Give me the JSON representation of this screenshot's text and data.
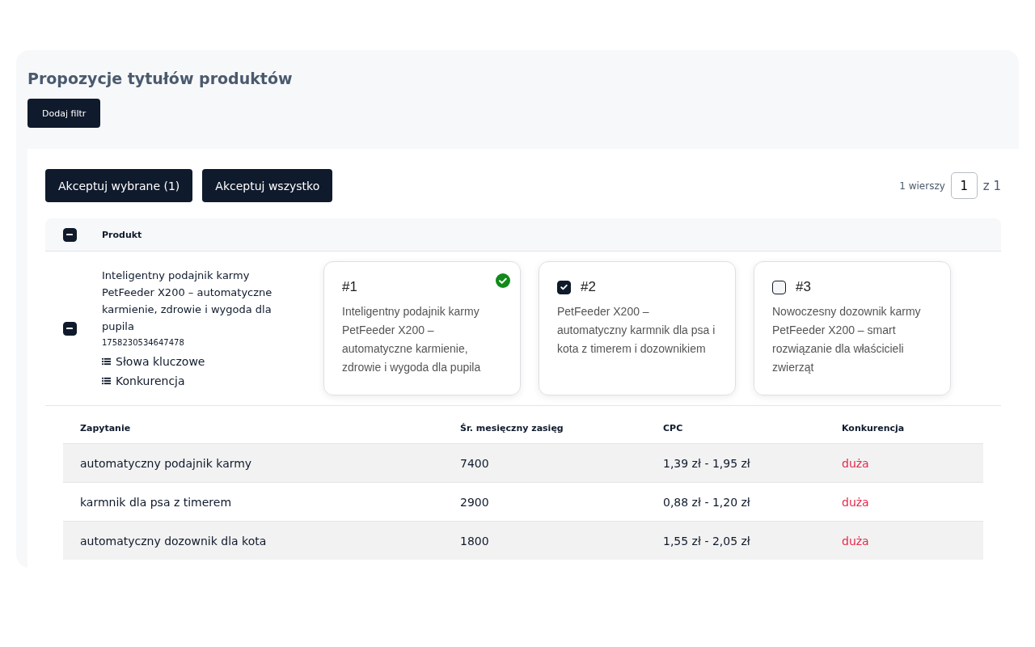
{
  "page": {
    "title": "Propozycje tytułów produktów",
    "filter_button": "Dodaj filtr"
  },
  "actions": [
    "Akceptuj wybrane (1)",
    "Akceptuj wszystko"
  ],
  "pagination": {
    "rows_label": "1 wierszy",
    "page": "1",
    "of": "z 1"
  },
  "table": {
    "header": {
      "indeterminate": true,
      "column": "Produkt"
    },
    "rows": [
      {
        "indeterminate": true,
        "title": "Inteligentny podajnik karmy PetFeeder X200 – automatyczne karmienie, zdrowie i wygoda dla pupila",
        "id": "1758230534647478",
        "links": [
          "Słowa kluczowe",
          "Konkurencja"
        ],
        "proposals": [
          {
            "kind": "current",
            "number": "#1",
            "text": "Inteligentny podajnik karmy PetFeeder X200 – automatyczne karmienie, zdrowie i wygoda dla pupila"
          },
          {
            "kind": "option",
            "checked": true,
            "number": "#2",
            "text": "PetFeeder X200 – automatyczny karmnik dla psa i kota z timerem i dozownikiem"
          },
          {
            "kind": "option",
            "checked": false,
            "number": "#3",
            "text": "Nowoczesny dozownik karmy PetFeeder X200 – smart rozwiązanie dla właścicieli zwierząt"
          }
        ]
      }
    ]
  },
  "keywords": {
    "columns": [
      "Zapytanie",
      "Śr. mesięczny zasięg",
      "CPC",
      "Konkurencja"
    ],
    "rows": [
      {
        "query": "automatyczny podajnik karmy",
        "reach": "7400",
        "cpc": "1,39 zł - 1,95 zł",
        "competition": "duża",
        "color": "#e5294a"
      },
      {
        "query": "karmnik dla psa z timerem",
        "reach": "2900",
        "cpc": "0,88 zł - 1,20 zł",
        "competition": "duża",
        "color": "#e5294a"
      },
      {
        "query": "automatyczny dozownik dla kota",
        "reach": "1800",
        "cpc": "1,55 zł - 2,05 zł",
        "competition": "duża",
        "color": "#e5294a"
      }
    ]
  }
}
